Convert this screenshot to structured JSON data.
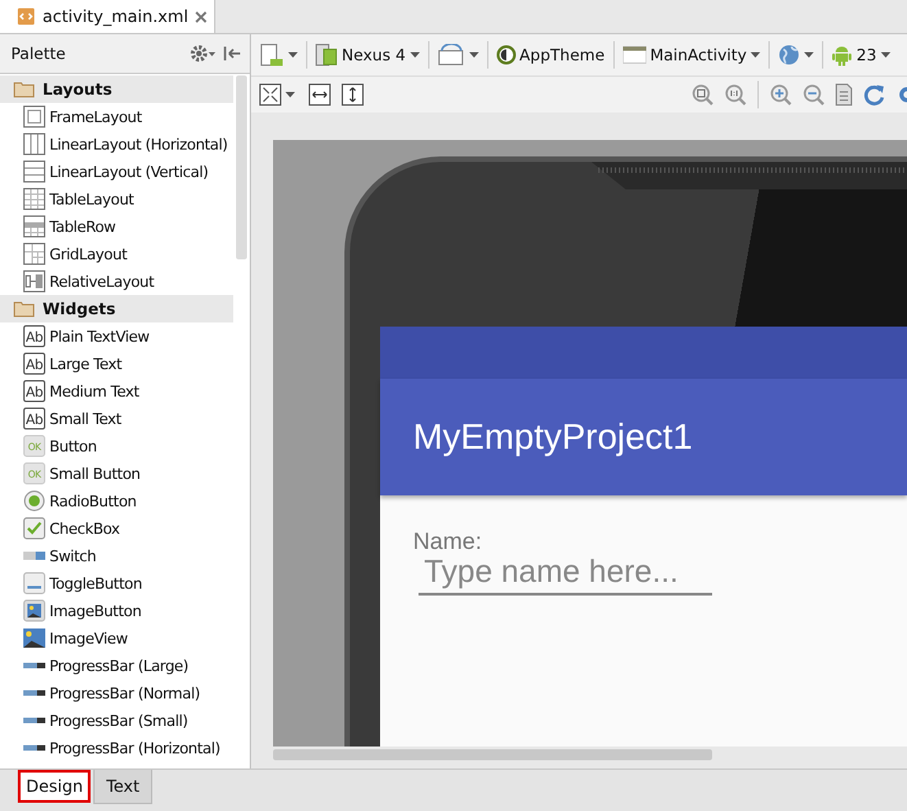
{
  "editor_tabs": [
    {
      "label": "activity_main.xml",
      "selected": true
    }
  ],
  "palette": {
    "title": "Palette",
    "sections": [
      {
        "label": "Layouts",
        "items": [
          {
            "label": "FrameLayout",
            "kind": "frame"
          },
          {
            "label": "LinearLayout (Horizontal)",
            "kind": "linear-h"
          },
          {
            "label": "LinearLayout (Vertical)",
            "kind": "linear-v"
          },
          {
            "label": "TableLayout",
            "kind": "table"
          },
          {
            "label": "TableRow",
            "kind": "tablerow"
          },
          {
            "label": "GridLayout",
            "kind": "grid"
          },
          {
            "label": "RelativeLayout",
            "kind": "relative"
          }
        ]
      },
      {
        "label": "Widgets",
        "items": [
          {
            "label": "Plain TextView",
            "kind": "text",
            "icon_text": "Ab"
          },
          {
            "label": "Large Text",
            "kind": "text",
            "icon_text": "Ab"
          },
          {
            "label": "Medium Text",
            "kind": "text",
            "icon_text": "Ab"
          },
          {
            "label": "Small Text",
            "kind": "text",
            "icon_text": "Ab"
          },
          {
            "label": "Button",
            "kind": "button",
            "icon_text": "OK"
          },
          {
            "label": "Small Button",
            "kind": "button",
            "icon_text": "OK"
          },
          {
            "label": "RadioButton",
            "kind": "radio"
          },
          {
            "label": "CheckBox",
            "kind": "checkbox"
          },
          {
            "label": "Switch",
            "kind": "switch"
          },
          {
            "label": "ToggleButton",
            "kind": "toggle"
          },
          {
            "label": "ImageButton",
            "kind": "imagebutton"
          },
          {
            "label": "ImageView",
            "kind": "imageview"
          },
          {
            "label": "ProgressBar (Large)",
            "kind": "progress"
          },
          {
            "label": "ProgressBar (Normal)",
            "kind": "progress"
          },
          {
            "label": "ProgressBar (Small)",
            "kind": "progress"
          },
          {
            "label": "ProgressBar (Horizontal)",
            "kind": "progress"
          }
        ]
      }
    ]
  },
  "toolbar": {
    "device": "Nexus 4",
    "theme": "AppTheme",
    "activity": "MainActivity",
    "api": "23"
  },
  "preview": {
    "app_title": "MyEmptyProject1",
    "label": "Name:",
    "placeholder": "Type name here..."
  },
  "bottom_tabs": [
    {
      "label": "Design",
      "selected": true
    },
    {
      "label": "Text",
      "selected": false
    }
  ]
}
